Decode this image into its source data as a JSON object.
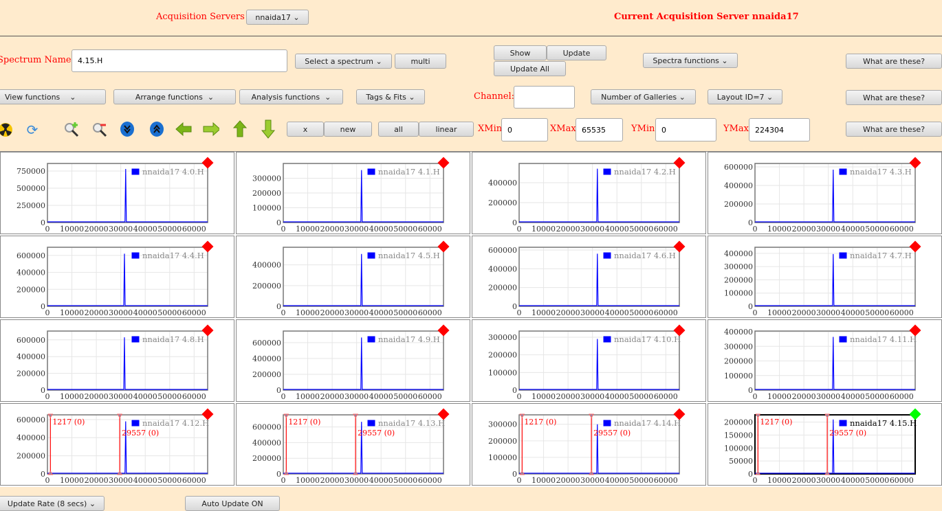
{
  "header": {
    "servers_label": "Acquisition Servers",
    "server_select": "nnaida17",
    "current_label": "Current Acquisition Server nnaida17"
  },
  "row1": {
    "spectrum_name_label": "Spectrum Name:",
    "spectrum_name_value": "4.15.H",
    "select_spectrum": "Select a spectrum",
    "multi": "multi",
    "show": "Show",
    "update": "Update",
    "update_all": "Update All",
    "spectra_functions": "Spectra functions",
    "what": "What are these?"
  },
  "row2": {
    "view": "View functions",
    "arrange": "Arrange functions",
    "analysis": "Analysis functions",
    "tags": "Tags & Fits",
    "channel_label": "Channel:",
    "channel_value": "",
    "galleries": "Number of Galleries",
    "layout": "Layout ID=7",
    "what": "What are these?"
  },
  "row3": {
    "x": "x",
    "new": "new",
    "all": "all",
    "linear": "linear",
    "xmin_label": "XMin",
    "xmin": "0",
    "xmax_label": "XMax",
    "xmax": "65535",
    "ymin_label": "YMin",
    "ymin": "0",
    "ymax_label": "YMax",
    "ymax": "224304",
    "what": "What are these?"
  },
  "icons": [
    "radiation-icon",
    "refresh-icon",
    "zoom-in-icon",
    "zoom-out-icon",
    "expand-down-icon",
    "expand-up-icon",
    "arrow-left-icon",
    "arrow-right-icon",
    "arrow-up-icon",
    "arrow-down-icon"
  ],
  "footer": {
    "rate": "Update Rate (8 secs)",
    "auto": "Auto Update ON"
  },
  "colors": {
    "accent": "#ff0000",
    "series": "#0000ff",
    "selected": "#00ff00"
  },
  "chart_data": [
    {
      "type": "line",
      "title": "nnaida17 4.0.H",
      "xlim": [
        0,
        65535
      ],
      "ylim": [
        0,
        860000
      ],
      "yticks": [
        0,
        250000,
        500000,
        750000
      ],
      "peak": [
        32000,
        780000
      ]
    },
    {
      "type": "line",
      "title": "nnaida17 4.1.H",
      "xlim": [
        0,
        65535
      ],
      "ylim": [
        0,
        400000
      ],
      "yticks": [
        0,
        100000,
        200000,
        300000
      ],
      "peak": [
        32000,
        355000
      ]
    },
    {
      "type": "line",
      "title": "nnaida17 4.2.H",
      "xlim": [
        0,
        65535
      ],
      "ylim": [
        0,
        593000
      ],
      "yticks": [
        0,
        200000,
        400000
      ],
      "peak": [
        32000,
        540000
      ]
    },
    {
      "type": "line",
      "title": "nnaida17 4.3.H",
      "xlim": [
        0,
        65535
      ],
      "ylim": [
        0,
        637000
      ],
      "yticks": [
        0,
        200000,
        400000,
        600000
      ],
      "peak": [
        32000,
        570000
      ]
    },
    {
      "type": "line",
      "title": "nnaida17 4.4.H",
      "xlim": [
        0,
        65535
      ],
      "ylim": [
        0,
        696000
      ],
      "yticks": [
        0,
        200000,
        400000,
        600000
      ],
      "peak": [
        31500,
        620000
      ]
    },
    {
      "type": "line",
      "title": "nnaida17 4.5.H",
      "xlim": [
        0,
        65535
      ],
      "ylim": [
        0,
        570000
      ],
      "yticks": [
        0,
        200000,
        400000
      ],
      "peak": [
        32000,
        505000
      ]
    },
    {
      "type": "line",
      "title": "nnaida17 4.6.H",
      "xlim": [
        0,
        65535
      ],
      "ylim": [
        0,
        629000
      ],
      "yticks": [
        0,
        200000,
        400000,
        600000
      ],
      "peak": [
        32000,
        560000
      ]
    },
    {
      "type": "line",
      "title": "nnaida17 4.7.H",
      "xlim": [
        0,
        65535
      ],
      "ylim": [
        0,
        446000
      ],
      "yticks": [
        0,
        100000,
        200000,
        300000,
        400000
      ],
      "peak": [
        32000,
        395000
      ]
    },
    {
      "type": "line",
      "title": "nnaida17 4.8.H",
      "xlim": [
        0,
        65535
      ],
      "ylim": [
        0,
        705000
      ],
      "yticks": [
        0,
        200000,
        400000,
        600000
      ],
      "peak": [
        31500,
        630000
      ]
    },
    {
      "type": "line",
      "title": "nnaida17 4.9.H",
      "xlim": [
        0,
        65535
      ],
      "ylim": [
        0,
        746000
      ],
      "yticks": [
        0,
        200000,
        400000,
        600000
      ],
      "peak": [
        32000,
        665000
      ]
    },
    {
      "type": "line",
      "title": "nnaida17 4.10.H",
      "xlim": [
        0,
        65535
      ],
      "ylim": [
        0,
        335000
      ],
      "yticks": [
        0,
        100000,
        200000,
        300000
      ],
      "peak": [
        32000,
        290000
      ]
    },
    {
      "type": "line",
      "title": "nnaida17 4.11.H",
      "xlim": [
        0,
        65535
      ],
      "ylim": [
        0,
        405000
      ],
      "yticks": [
        0,
        100000,
        200000,
        300000,
        400000
      ],
      "peak": [
        32000,
        365000
      ]
    },
    {
      "type": "line",
      "title": "nnaida17 4.12.H",
      "xlim": [
        0,
        65535
      ],
      "ylim": [
        0,
        652000
      ],
      "yticks": [
        0,
        200000,
        400000,
        600000
      ],
      "peak": [
        32000,
        580000
      ],
      "markers": [
        {
          "x": 1217,
          "label": "1217 (0)"
        },
        {
          "x": 29557,
          "label": "29557 (0)"
        }
      ]
    },
    {
      "type": "line",
      "title": "nnaida17 4.13.H",
      "xlim": [
        0,
        65535
      ],
      "ylim": [
        0,
        754000
      ],
      "yticks": [
        0,
        200000,
        400000,
        600000
      ],
      "peak": [
        32000,
        665000
      ],
      "markers": [
        {
          "x": 1217,
          "label": "1217 (0)"
        },
        {
          "x": 29557,
          "label": "29557 (0)"
        }
      ]
    },
    {
      "type": "line",
      "title": "nnaida17 4.14.H",
      "xlim": [
        0,
        65535
      ],
      "ylim": [
        0,
        357000
      ],
      "yticks": [
        0,
        100000,
        200000,
        300000
      ],
      "peak": [
        32000,
        300000
      ],
      "markers": [
        {
          "x": 1217,
          "label": "1217 (0)"
        },
        {
          "x": 29557,
          "label": "29557 (0)"
        }
      ]
    },
    {
      "type": "line",
      "title": "nnaida17 4.15.H",
      "xlim": [
        0,
        65535
      ],
      "ylim": [
        0,
        228000
      ],
      "yticks": [
        0,
        50000,
        100000,
        150000,
        200000
      ],
      "peak": [
        32000,
        210000
      ],
      "selected": true,
      "markers": [
        {
          "x": 1217,
          "label": "1217 (0)"
        },
        {
          "x": 29557,
          "label": "29557 (0)"
        }
      ]
    }
  ]
}
